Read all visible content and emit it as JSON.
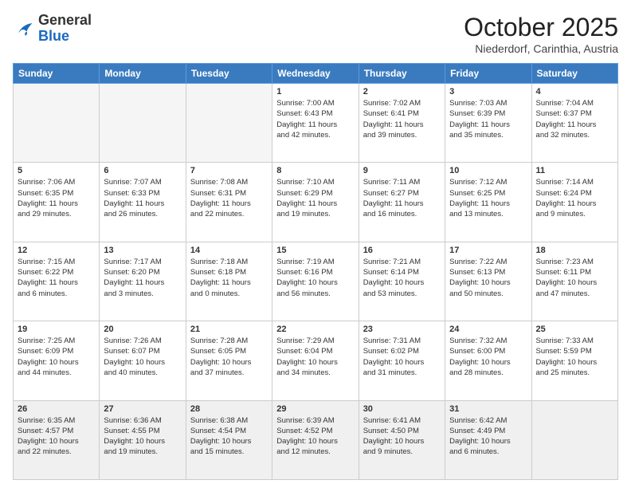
{
  "header": {
    "logo_general": "General",
    "logo_blue": "Blue",
    "month": "October 2025",
    "location": "Niederdorf, Carinthia, Austria"
  },
  "weekdays": [
    "Sunday",
    "Monday",
    "Tuesday",
    "Wednesday",
    "Thursday",
    "Friday",
    "Saturday"
  ],
  "weeks": [
    [
      {
        "day": "",
        "info": ""
      },
      {
        "day": "",
        "info": ""
      },
      {
        "day": "",
        "info": ""
      },
      {
        "day": "1",
        "info": "Sunrise: 7:00 AM\nSunset: 6:43 PM\nDaylight: 11 hours\nand 42 minutes."
      },
      {
        "day": "2",
        "info": "Sunrise: 7:02 AM\nSunset: 6:41 PM\nDaylight: 11 hours\nand 39 minutes."
      },
      {
        "day": "3",
        "info": "Sunrise: 7:03 AM\nSunset: 6:39 PM\nDaylight: 11 hours\nand 35 minutes."
      },
      {
        "day": "4",
        "info": "Sunrise: 7:04 AM\nSunset: 6:37 PM\nDaylight: 11 hours\nand 32 minutes."
      }
    ],
    [
      {
        "day": "5",
        "info": "Sunrise: 7:06 AM\nSunset: 6:35 PM\nDaylight: 11 hours\nand 29 minutes."
      },
      {
        "day": "6",
        "info": "Sunrise: 7:07 AM\nSunset: 6:33 PM\nDaylight: 11 hours\nand 26 minutes."
      },
      {
        "day": "7",
        "info": "Sunrise: 7:08 AM\nSunset: 6:31 PM\nDaylight: 11 hours\nand 22 minutes."
      },
      {
        "day": "8",
        "info": "Sunrise: 7:10 AM\nSunset: 6:29 PM\nDaylight: 11 hours\nand 19 minutes."
      },
      {
        "day": "9",
        "info": "Sunrise: 7:11 AM\nSunset: 6:27 PM\nDaylight: 11 hours\nand 16 minutes."
      },
      {
        "day": "10",
        "info": "Sunrise: 7:12 AM\nSunset: 6:25 PM\nDaylight: 11 hours\nand 13 minutes."
      },
      {
        "day": "11",
        "info": "Sunrise: 7:14 AM\nSunset: 6:24 PM\nDaylight: 11 hours\nand 9 minutes."
      }
    ],
    [
      {
        "day": "12",
        "info": "Sunrise: 7:15 AM\nSunset: 6:22 PM\nDaylight: 11 hours\nand 6 minutes."
      },
      {
        "day": "13",
        "info": "Sunrise: 7:17 AM\nSunset: 6:20 PM\nDaylight: 11 hours\nand 3 minutes."
      },
      {
        "day": "14",
        "info": "Sunrise: 7:18 AM\nSunset: 6:18 PM\nDaylight: 11 hours\nand 0 minutes."
      },
      {
        "day": "15",
        "info": "Sunrise: 7:19 AM\nSunset: 6:16 PM\nDaylight: 10 hours\nand 56 minutes."
      },
      {
        "day": "16",
        "info": "Sunrise: 7:21 AM\nSunset: 6:14 PM\nDaylight: 10 hours\nand 53 minutes."
      },
      {
        "day": "17",
        "info": "Sunrise: 7:22 AM\nSunset: 6:13 PM\nDaylight: 10 hours\nand 50 minutes."
      },
      {
        "day": "18",
        "info": "Sunrise: 7:23 AM\nSunset: 6:11 PM\nDaylight: 10 hours\nand 47 minutes."
      }
    ],
    [
      {
        "day": "19",
        "info": "Sunrise: 7:25 AM\nSunset: 6:09 PM\nDaylight: 10 hours\nand 44 minutes."
      },
      {
        "day": "20",
        "info": "Sunrise: 7:26 AM\nSunset: 6:07 PM\nDaylight: 10 hours\nand 40 minutes."
      },
      {
        "day": "21",
        "info": "Sunrise: 7:28 AM\nSunset: 6:05 PM\nDaylight: 10 hours\nand 37 minutes."
      },
      {
        "day": "22",
        "info": "Sunrise: 7:29 AM\nSunset: 6:04 PM\nDaylight: 10 hours\nand 34 minutes."
      },
      {
        "day": "23",
        "info": "Sunrise: 7:31 AM\nSunset: 6:02 PM\nDaylight: 10 hours\nand 31 minutes."
      },
      {
        "day": "24",
        "info": "Sunrise: 7:32 AM\nSunset: 6:00 PM\nDaylight: 10 hours\nand 28 minutes."
      },
      {
        "day": "25",
        "info": "Sunrise: 7:33 AM\nSunset: 5:59 PM\nDaylight: 10 hours\nand 25 minutes."
      }
    ],
    [
      {
        "day": "26",
        "info": "Sunrise: 6:35 AM\nSunset: 4:57 PM\nDaylight: 10 hours\nand 22 minutes."
      },
      {
        "day": "27",
        "info": "Sunrise: 6:36 AM\nSunset: 4:55 PM\nDaylight: 10 hours\nand 19 minutes."
      },
      {
        "day": "28",
        "info": "Sunrise: 6:38 AM\nSunset: 4:54 PM\nDaylight: 10 hours\nand 15 minutes."
      },
      {
        "day": "29",
        "info": "Sunrise: 6:39 AM\nSunset: 4:52 PM\nDaylight: 10 hours\nand 12 minutes."
      },
      {
        "day": "30",
        "info": "Sunrise: 6:41 AM\nSunset: 4:50 PM\nDaylight: 10 hours\nand 9 minutes."
      },
      {
        "day": "31",
        "info": "Sunrise: 6:42 AM\nSunset: 4:49 PM\nDaylight: 10 hours\nand 6 minutes."
      },
      {
        "day": "",
        "info": ""
      }
    ]
  ]
}
